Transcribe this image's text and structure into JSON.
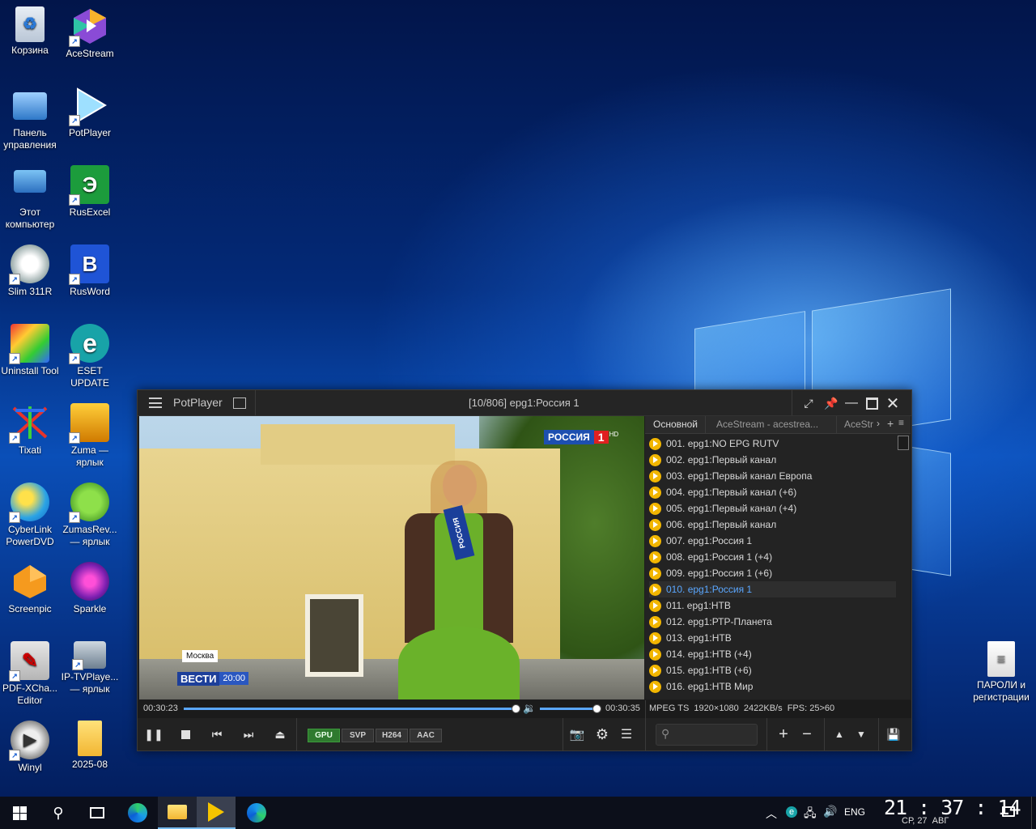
{
  "desktop": {
    "icons": [
      {
        "label": "Корзина"
      },
      {
        "label": "AceStream"
      },
      {
        "label": "Панель управления"
      },
      {
        "label": "PotPlayer"
      },
      {
        "label": "Этот компьютер"
      },
      {
        "label": "RusExcel"
      },
      {
        "label": "Slim 311R"
      },
      {
        "label": "RusWord"
      },
      {
        "label": "Uninstall Tool"
      },
      {
        "label": "ESET UPDATE"
      },
      {
        "label": "Tixati"
      },
      {
        "label": "Zuma — ярлык"
      },
      {
        "label": "CyberLink PowerDVD"
      },
      {
        "label": "ZumasRev... — ярлык"
      },
      {
        "label": "Screenpic"
      },
      {
        "label": "Sparkle"
      },
      {
        "label": "PDF-XCha... Editor"
      },
      {
        "label": "IP-TVPlaye... — ярлык"
      },
      {
        "label": "Winyl"
      },
      {
        "label": "2025-08"
      },
      {
        "label": "ПАРОЛИ и регистрации"
      }
    ],
    "icon_glyphs": {
      "rusexcel": "Э",
      "rusword": "B",
      "eset": "e"
    }
  },
  "player": {
    "app_name": "PotPlayer",
    "title": "[10/806] epg1:Россия 1",
    "video": {
      "channel_logo": "РОССИЯ",
      "channel_num": "1",
      "hd": "HD",
      "location": "Москва",
      "program": "ВЕСТИ",
      "program_time": "20:00",
      "mic_text": "РОССИЯ"
    },
    "playlist_tabs": [
      "Основной",
      "AceStream - acestrea...",
      "AceStr"
    ],
    "playlist": [
      {
        "label": "001. epg1:NO EPG RUTV"
      },
      {
        "label": "002. epg1:Первый канал"
      },
      {
        "label": "003. epg1:Первый канал Европа"
      },
      {
        "label": "004. epg1:Первый канал (+6)"
      },
      {
        "label": "005. epg1:Первый канал (+4)"
      },
      {
        "label": "006. epg1:Первый канал"
      },
      {
        "label": "007. epg1:Россия 1"
      },
      {
        "label": "008. epg1:Россия 1 (+4)"
      },
      {
        "label": "009. epg1:Россия 1 (+6)"
      },
      {
        "label": "010. epg1:Россия 1"
      },
      {
        "label": "011. epg1:НТВ"
      },
      {
        "label": "012. epg1:РТР-Планета"
      },
      {
        "label": "013. epg1:НТВ"
      },
      {
        "label": "014. epg1:НТВ (+4)"
      },
      {
        "label": "015. epg1:НТВ (+6)"
      },
      {
        "label": "016. epg1:НТВ Мир"
      }
    ],
    "active_index": 9,
    "time_current": "00:30:23",
    "time_total": "00:30:35",
    "progress_fraction": 0.99,
    "volume_fraction": 1.0,
    "info": "MPEG TS  1920×1080  2422KB/s  FPS: 25>60",
    "badges": [
      "GPU",
      "SVP",
      "H264",
      "AAC"
    ]
  },
  "taskbar": {
    "lang": "ENG",
    "time": "21 : 37 : 14",
    "date": "СР, 27  АВГ"
  },
  "colors": {
    "accent": "#5aa7ff",
    "play_dot": "#f2b600",
    "gpu_badge": "#2f7a2f"
  }
}
